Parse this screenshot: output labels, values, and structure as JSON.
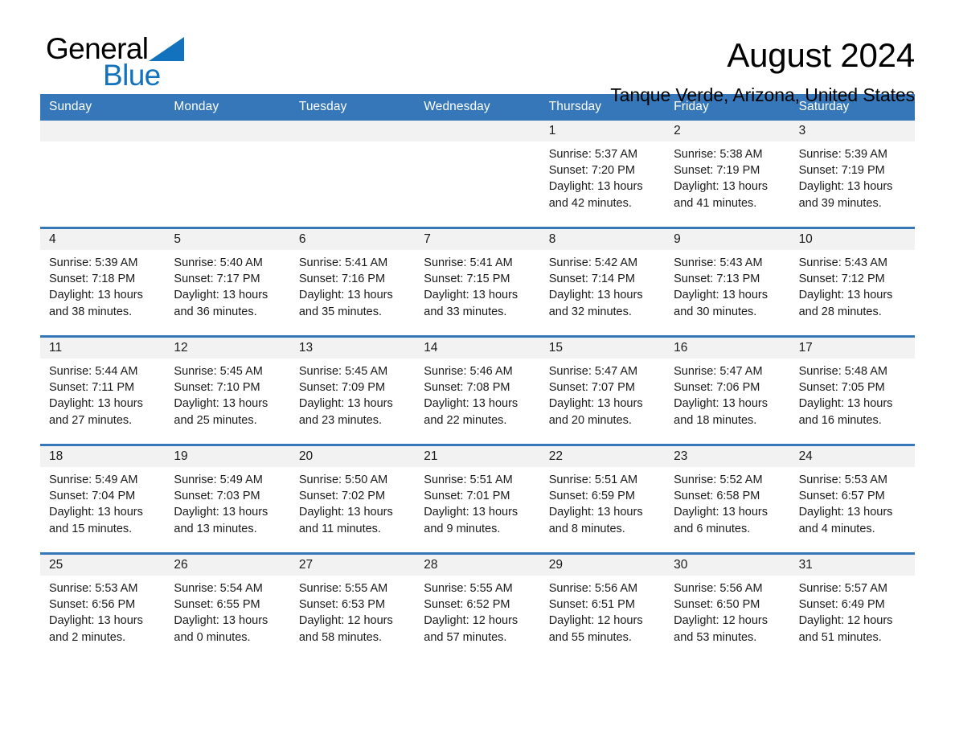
{
  "brand": {
    "name_part1": "General",
    "name_part2": "Blue",
    "triangle_color": "#1272bd"
  },
  "header": {
    "title": "August 2024",
    "subtitle": "Tanque Verde, Arizona, United States"
  },
  "theme": {
    "header_blue": "#3577b9",
    "date_band_gray": "#f2f2f2",
    "text_dark": "#1a1a1a",
    "brand_blue": "#1272bd"
  },
  "calendar": {
    "weekdays": [
      "Sunday",
      "Monday",
      "Tuesday",
      "Wednesday",
      "Thursday",
      "Friday",
      "Saturday"
    ],
    "weeks": [
      [
        {
          "day": "",
          "sunrise": "",
          "sunset": "",
          "daylight": "",
          "empty": true
        },
        {
          "day": "",
          "sunrise": "",
          "sunset": "",
          "daylight": "",
          "empty": true
        },
        {
          "day": "",
          "sunrise": "",
          "sunset": "",
          "daylight": "",
          "empty": true
        },
        {
          "day": "",
          "sunrise": "",
          "sunset": "",
          "daylight": "",
          "empty": true
        },
        {
          "day": "1",
          "sunrise": "Sunrise: 5:37 AM",
          "sunset": "Sunset: 7:20 PM",
          "daylight": "Daylight: 13 hours and 42 minutes.",
          "empty": false
        },
        {
          "day": "2",
          "sunrise": "Sunrise: 5:38 AM",
          "sunset": "Sunset: 7:19 PM",
          "daylight": "Daylight: 13 hours and 41 minutes.",
          "empty": false
        },
        {
          "day": "3",
          "sunrise": "Sunrise: 5:39 AM",
          "sunset": "Sunset: 7:19 PM",
          "daylight": "Daylight: 13 hours and 39 minutes.",
          "empty": false
        }
      ],
      [
        {
          "day": "4",
          "sunrise": "Sunrise: 5:39 AM",
          "sunset": "Sunset: 7:18 PM",
          "daylight": "Daylight: 13 hours and 38 minutes.",
          "empty": false
        },
        {
          "day": "5",
          "sunrise": "Sunrise: 5:40 AM",
          "sunset": "Sunset: 7:17 PM",
          "daylight": "Daylight: 13 hours and 36 minutes.",
          "empty": false
        },
        {
          "day": "6",
          "sunrise": "Sunrise: 5:41 AM",
          "sunset": "Sunset: 7:16 PM",
          "daylight": "Daylight: 13 hours and 35 minutes.",
          "empty": false
        },
        {
          "day": "7",
          "sunrise": "Sunrise: 5:41 AM",
          "sunset": "Sunset: 7:15 PM",
          "daylight": "Daylight: 13 hours and 33 minutes.",
          "empty": false
        },
        {
          "day": "8",
          "sunrise": "Sunrise: 5:42 AM",
          "sunset": "Sunset: 7:14 PM",
          "daylight": "Daylight: 13 hours and 32 minutes.",
          "empty": false
        },
        {
          "day": "9",
          "sunrise": "Sunrise: 5:43 AM",
          "sunset": "Sunset: 7:13 PM",
          "daylight": "Daylight: 13 hours and 30 minutes.",
          "empty": false
        },
        {
          "day": "10",
          "sunrise": "Sunrise: 5:43 AM",
          "sunset": "Sunset: 7:12 PM",
          "daylight": "Daylight: 13 hours and 28 minutes.",
          "empty": false
        }
      ],
      [
        {
          "day": "11",
          "sunrise": "Sunrise: 5:44 AM",
          "sunset": "Sunset: 7:11 PM",
          "daylight": "Daylight: 13 hours and 27 minutes.",
          "empty": false
        },
        {
          "day": "12",
          "sunrise": "Sunrise: 5:45 AM",
          "sunset": "Sunset: 7:10 PM",
          "daylight": "Daylight: 13 hours and 25 minutes.",
          "empty": false
        },
        {
          "day": "13",
          "sunrise": "Sunrise: 5:45 AM",
          "sunset": "Sunset: 7:09 PM",
          "daylight": "Daylight: 13 hours and 23 minutes.",
          "empty": false
        },
        {
          "day": "14",
          "sunrise": "Sunrise: 5:46 AM",
          "sunset": "Sunset: 7:08 PM",
          "daylight": "Daylight: 13 hours and 22 minutes.",
          "empty": false
        },
        {
          "day": "15",
          "sunrise": "Sunrise: 5:47 AM",
          "sunset": "Sunset: 7:07 PM",
          "daylight": "Daylight: 13 hours and 20 minutes.",
          "empty": false
        },
        {
          "day": "16",
          "sunrise": "Sunrise: 5:47 AM",
          "sunset": "Sunset: 7:06 PM",
          "daylight": "Daylight: 13 hours and 18 minutes.",
          "empty": false
        },
        {
          "day": "17",
          "sunrise": "Sunrise: 5:48 AM",
          "sunset": "Sunset: 7:05 PM",
          "daylight": "Daylight: 13 hours and 16 minutes.",
          "empty": false
        }
      ],
      [
        {
          "day": "18",
          "sunrise": "Sunrise: 5:49 AM",
          "sunset": "Sunset: 7:04 PM",
          "daylight": "Daylight: 13 hours and 15 minutes.",
          "empty": false
        },
        {
          "day": "19",
          "sunrise": "Sunrise: 5:49 AM",
          "sunset": "Sunset: 7:03 PM",
          "daylight": "Daylight: 13 hours and 13 minutes.",
          "empty": false
        },
        {
          "day": "20",
          "sunrise": "Sunrise: 5:50 AM",
          "sunset": "Sunset: 7:02 PM",
          "daylight": "Daylight: 13 hours and 11 minutes.",
          "empty": false
        },
        {
          "day": "21",
          "sunrise": "Sunrise: 5:51 AM",
          "sunset": "Sunset: 7:01 PM",
          "daylight": "Daylight: 13 hours and 9 minutes.",
          "empty": false
        },
        {
          "day": "22",
          "sunrise": "Sunrise: 5:51 AM",
          "sunset": "Sunset: 6:59 PM",
          "daylight": "Daylight: 13 hours and 8 minutes.",
          "empty": false
        },
        {
          "day": "23",
          "sunrise": "Sunrise: 5:52 AM",
          "sunset": "Sunset: 6:58 PM",
          "daylight": "Daylight: 13 hours and 6 minutes.",
          "empty": false
        },
        {
          "day": "24",
          "sunrise": "Sunrise: 5:53 AM",
          "sunset": "Sunset: 6:57 PM",
          "daylight": "Daylight: 13 hours and 4 minutes.",
          "empty": false
        }
      ],
      [
        {
          "day": "25",
          "sunrise": "Sunrise: 5:53 AM",
          "sunset": "Sunset: 6:56 PM",
          "daylight": "Daylight: 13 hours and 2 minutes.",
          "empty": false
        },
        {
          "day": "26",
          "sunrise": "Sunrise: 5:54 AM",
          "sunset": "Sunset: 6:55 PM",
          "daylight": "Daylight: 13 hours and 0 minutes.",
          "empty": false
        },
        {
          "day": "27",
          "sunrise": "Sunrise: 5:55 AM",
          "sunset": "Sunset: 6:53 PM",
          "daylight": "Daylight: 12 hours and 58 minutes.",
          "empty": false
        },
        {
          "day": "28",
          "sunrise": "Sunrise: 5:55 AM",
          "sunset": "Sunset: 6:52 PM",
          "daylight": "Daylight: 12 hours and 57 minutes.",
          "empty": false
        },
        {
          "day": "29",
          "sunrise": "Sunrise: 5:56 AM",
          "sunset": "Sunset: 6:51 PM",
          "daylight": "Daylight: 12 hours and 55 minutes.",
          "empty": false
        },
        {
          "day": "30",
          "sunrise": "Sunrise: 5:56 AM",
          "sunset": "Sunset: 6:50 PM",
          "daylight": "Daylight: 12 hours and 53 minutes.",
          "empty": false
        },
        {
          "day": "31",
          "sunrise": "Sunrise: 5:57 AM",
          "sunset": "Sunset: 6:49 PM",
          "daylight": "Daylight: 12 hours and 51 minutes.",
          "empty": false
        }
      ]
    ]
  }
}
